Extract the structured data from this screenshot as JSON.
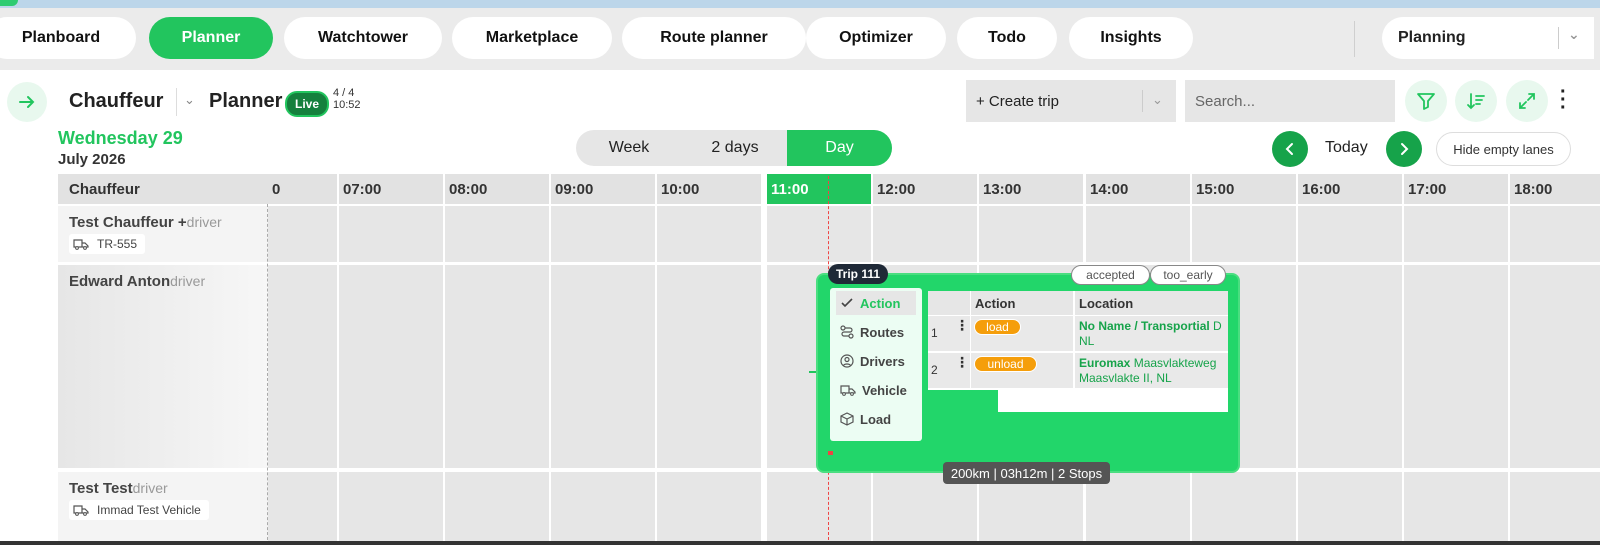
{
  "nav": {
    "tabs": [
      {
        "label": "Planboard",
        "active": false
      },
      {
        "label": "Planner",
        "active": true
      },
      {
        "label": "Watchtower",
        "active": false
      },
      {
        "label": "Marketplace",
        "active": false
      },
      {
        "label": "Route planner",
        "active": false
      },
      {
        "label": "Optimizer",
        "active": false
      },
      {
        "label": "Todo",
        "active": false
      },
      {
        "label": "Insights",
        "active": false
      }
    ],
    "mode_select": "Planning"
  },
  "header": {
    "title": "Chauffeur",
    "subtitle": "Planner",
    "live_label": "Live",
    "count": "4 / 4",
    "time": "10:52"
  },
  "toolbar": {
    "create_trip": "+ Create trip",
    "search_placeholder": "Search..."
  },
  "date": {
    "weekday_line": "Wednesday 29",
    "month_line": "July 2026"
  },
  "view_toggle": [
    "Week",
    "2 days",
    "Day"
  ],
  "view_selected": "Day",
  "today_label": "Today",
  "hide_empty_label": "Hide empty lanes",
  "grid": {
    "first_column_header": "Chauffeur",
    "hours": [
      "0",
      "07:00",
      "08:00",
      "09:00",
      "10:00",
      "11:00",
      "12:00",
      "13:00",
      "14:00",
      "15:00",
      "16:00",
      "17:00",
      "18:00"
    ],
    "current_hour": "11:00",
    "lanes": [
      {
        "name": "Test Chauffeur +",
        "role": "driver",
        "vehicle": "TR-555"
      },
      {
        "name": "Edward Anton",
        "role": "driver",
        "vehicle": ""
      },
      {
        "name": "Test Test",
        "role": "driver",
        "vehicle": "Immad Test Vehicle"
      }
    ]
  },
  "trip": {
    "label": "Trip 111",
    "statuses": [
      "accepted",
      "too_early"
    ],
    "menu": [
      "Action",
      "Routes",
      "Drivers",
      "Vehicle",
      "Load"
    ],
    "menu_active": "Action",
    "table_headers": [
      "Action",
      "Location"
    ],
    "stops": [
      {
        "index": "1",
        "action": "load",
        "location_bold": "No Name / Transportial",
        "location_rest": " D",
        "location_line2": "NL"
      },
      {
        "index": "2",
        "action": "unload",
        "location_bold": "Euromax",
        "location_rest": " Maasvlakteweg",
        "location_line2": "Maasvlakte II, NL"
      }
    ],
    "summary": "200km | 03h12m | 2 Stops"
  },
  "colors": {
    "accent": "#22c55e",
    "accent_dark": "#16a34a",
    "badge": "#f59e0b"
  }
}
